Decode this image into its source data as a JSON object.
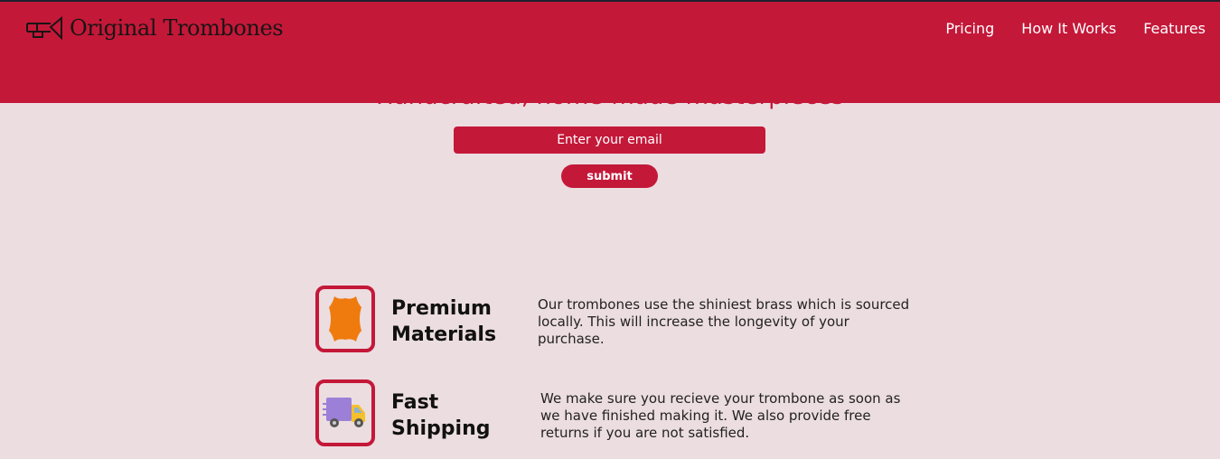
{
  "header": {
    "brand": "Original Trombones",
    "logo_icon": "trombone-icon",
    "nav": [
      {
        "label": "Pricing"
      },
      {
        "label": "How It Works"
      },
      {
        "label": "Features"
      }
    ]
  },
  "hero": {
    "title": "Handcrafted, home-made masterpieces",
    "email_placeholder": "Enter your email",
    "submit_label": "submit"
  },
  "features": [
    {
      "icon": "leather-icon",
      "title_line1": "Premium",
      "title_line2": "Materials",
      "description": "Our trombones use the shiniest brass which is sourced locally. This will increase the longevity of your purchase."
    },
    {
      "icon": "delivery-truck-icon",
      "title_line1": "Fast",
      "title_line2": "Shipping",
      "description": "We make sure you recieve your trombone as soon as we have finished making it. We also provide free returns if you are not satisfied."
    }
  ],
  "colors": {
    "brand_red": "#c41839",
    "page_background": "#ecdde0",
    "leather_orange": "#ef7b0e",
    "truck_purple": "#9c7fd6",
    "truck_yellow": "#f5c02a"
  }
}
